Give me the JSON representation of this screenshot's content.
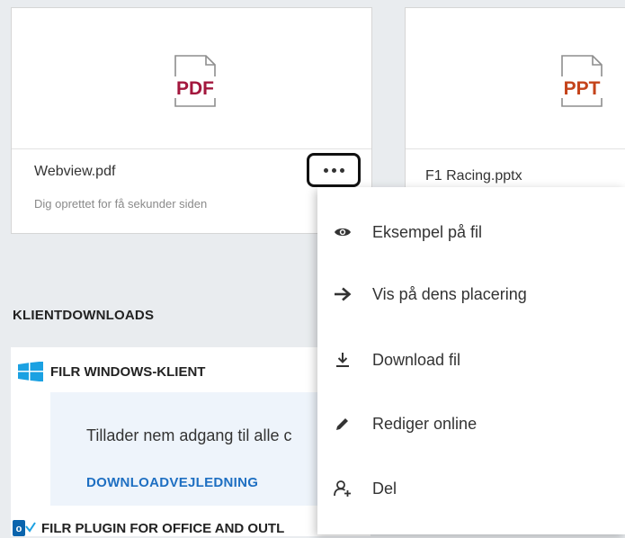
{
  "files": [
    {
      "name": "Webview.pdf",
      "meta": "Dig oprettet for få sekunder siden",
      "icon_label": "PDF",
      "icon": "pdf-file-icon",
      "color": "#a3173d"
    },
    {
      "name": "F1 Racing.pptx",
      "icon_label": "PPT",
      "icon": "ppt-file-icon",
      "color": "#c4431a"
    }
  ],
  "more_button": {
    "icon": "more-options-icon"
  },
  "section": {
    "title": "KLIENTDOWNLOADS"
  },
  "clients": [
    {
      "label": "FILR WINDOWS-KLIENT",
      "icon": "windows-logo-icon",
      "description": "Tillader nem adgang til alle c",
      "link": "DOWNLOADVEJLEDNING"
    },
    {
      "label": "FILR PLUGIN FOR OFFICE AND OUTL",
      "icon": "outlook-logo-icon"
    }
  ],
  "menu": {
    "items": [
      {
        "label": "Eksempel på fil",
        "icon": "eye-icon"
      },
      {
        "label": "Vis på dens placering",
        "icon": "arrow-right-icon"
      },
      {
        "label": "Download fil",
        "icon": "download-icon"
      },
      {
        "label": "Rediger online",
        "icon": "pencil-icon"
      },
      {
        "label": "Del",
        "icon": "share-user-icon"
      }
    ]
  },
  "colors": {
    "pdf": "#a3173d",
    "ppt": "#c4431a",
    "link": "#1e6fc2",
    "windows": "#1ba1e2",
    "outlook": "#0a64ad"
  }
}
